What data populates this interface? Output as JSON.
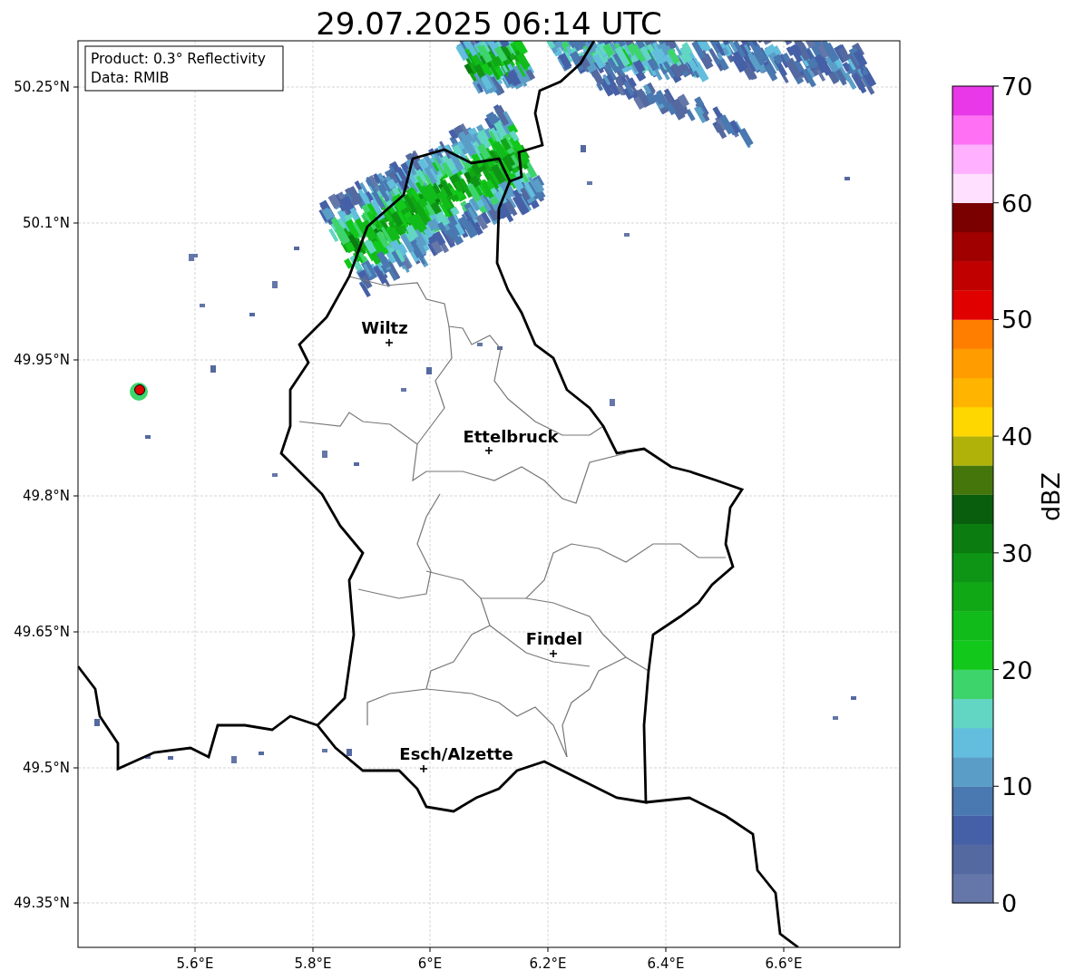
{
  "title": "29.07.2025 06:14 UTC",
  "info_box": [
    "Product: 0.3° Reflectivity",
    "Data: RMIB"
  ],
  "cities": [
    {
      "name": "Wiltz"
    },
    {
      "name": "Ettelbruck"
    },
    {
      "name": "Findel"
    },
    {
      "name": "Esch/Alzette"
    }
  ],
  "x_ticks": [
    "5.6°E",
    "5.8°E",
    "6°E",
    "6.2°E",
    "6.4°E",
    "6.6°E"
  ],
  "y_ticks": [
    "50.25°N",
    "50.1°N",
    "49.95°N",
    "49.8°N",
    "49.65°N",
    "49.5°N",
    "49.35°N"
  ],
  "colorbar": {
    "label": "dBZ",
    "ticks": [
      "70",
      "60",
      "50",
      "40",
      "30",
      "20",
      "10",
      "0"
    ],
    "bins": [
      {
        "color": "#6577a9"
      },
      {
        "color": "#5469a0"
      },
      {
        "color": "#4560a6"
      },
      {
        "color": "#4a78b0"
      },
      {
        "color": "#5a9ec8"
      },
      {
        "color": "#62bedc"
      },
      {
        "color": "#62d6c3"
      },
      {
        "color": "#3ed46c"
      },
      {
        "color": "#12c81a"
      },
      {
        "color": "#10bb1a"
      },
      {
        "color": "#10a815"
      },
      {
        "color": "#0e9515"
      },
      {
        "color": "#0a7c10"
      },
      {
        "color": "#085e0c"
      },
      {
        "color": "#44760c"
      },
      {
        "color": "#b0b20a"
      },
      {
        "color": "#ffd700"
      },
      {
        "color": "#ffb400"
      },
      {
        "color": "#ff9c00"
      },
      {
        "color": "#ff7e00"
      },
      {
        "color": "#e00000"
      },
      {
        "color": "#c00000"
      },
      {
        "color": "#a00000"
      },
      {
        "color": "#7a0000"
      },
      {
        "color": "#ffe0ff"
      },
      {
        "color": "#ffb0ff"
      },
      {
        "color": "#ff70f5"
      },
      {
        "color": "#e838e8"
      }
    ]
  }
}
